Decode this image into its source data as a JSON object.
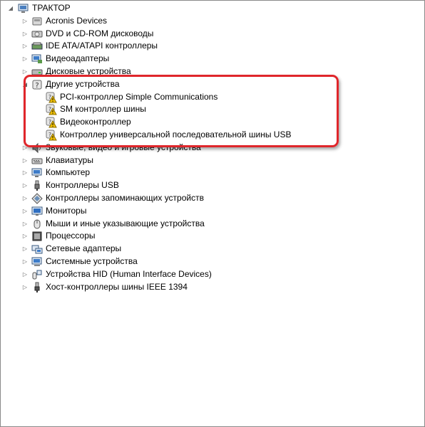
{
  "root": {
    "label": "ТРАКТОР",
    "icon": "computer-icon",
    "expanded": true
  },
  "categories": [
    {
      "label": "Acronis Devices",
      "icon": "acronis-device-icon"
    },
    {
      "label": "DVD и CD-ROM дисководы",
      "icon": "dvd-drive-icon"
    },
    {
      "label": "IDE ATA/ATAPI контроллеры",
      "icon": "ide-controller-icon"
    },
    {
      "label": "Видеоадаптеры",
      "icon": "display-adapter-icon"
    },
    {
      "label": "Дисковые устройства",
      "icon": "disk-drive-icon"
    },
    {
      "label": "Другие устройства",
      "icon": "unknown-device-icon",
      "expanded": true,
      "children": [
        {
          "label": "PCI-контроллер Simple Communications",
          "icon": "warning-device-icon"
        },
        {
          "label": "SM контроллер шины",
          "icon": "warning-device-icon"
        },
        {
          "label": "Видеоконтроллер",
          "icon": "warning-device-icon"
        },
        {
          "label": "Контроллер универсальной последовательной шины USB",
          "icon": "warning-device-icon"
        }
      ]
    },
    {
      "label": "Звуковые, видео и игровые устройства",
      "icon": "sound-icon"
    },
    {
      "label": "Клавиатуры",
      "icon": "keyboard-icon"
    },
    {
      "label": "Компьютер",
      "icon": "computer-icon"
    },
    {
      "label": "Контроллеры USB",
      "icon": "usb-icon"
    },
    {
      "label": "Контроллеры запоминающих устройств",
      "icon": "storage-controller-icon"
    },
    {
      "label": "Мониторы",
      "icon": "monitor-icon"
    },
    {
      "label": "Мыши и иные указывающие устройства",
      "icon": "mouse-icon"
    },
    {
      "label": "Процессоры",
      "icon": "processor-icon"
    },
    {
      "label": "Сетевые адаптеры",
      "icon": "network-adapter-icon"
    },
    {
      "label": "Системные устройства",
      "icon": "system-device-icon"
    },
    {
      "label": "Устройства HID (Human Interface Devices)",
      "icon": "hid-icon"
    },
    {
      "label": "Хост-контроллеры шины IEEE 1394",
      "icon": "ieee1394-icon"
    }
  ],
  "colors": {
    "highlight": "#e0262b",
    "warning": "#f2c200"
  }
}
